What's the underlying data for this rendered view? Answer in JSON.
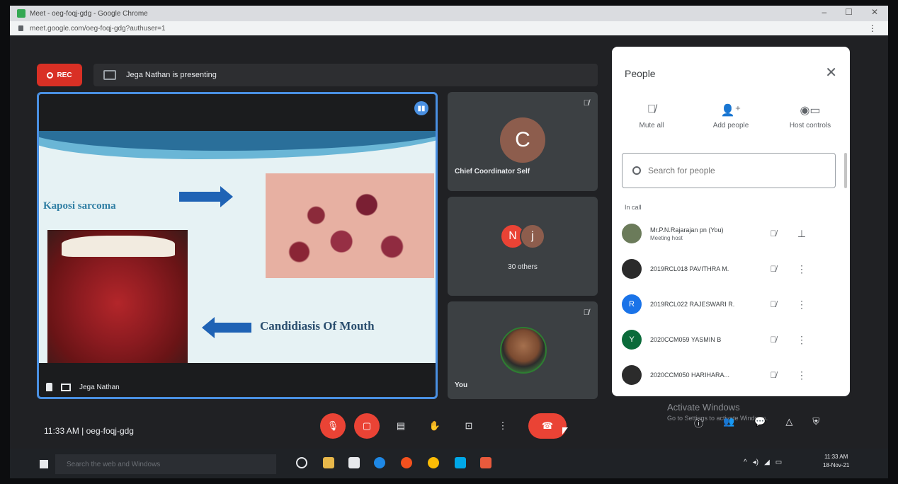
{
  "browser": {
    "title": "Meet - oeg-foqj-gdg - Google Chrome",
    "url": "meet.google.com/oeg-foqj-gdg?authuser=1"
  },
  "topbar": {
    "rec_label": "REC",
    "presenting_text": "Jega Nathan is presenting"
  },
  "main_tile": {
    "presenter_name": "Jega Nathan",
    "slide": {
      "label_top": "Kaposi sarcoma",
      "label_bottom": "Candidiasis Of Mouth"
    }
  },
  "side_tiles": {
    "coordinator": {
      "initial": "C",
      "name": "Chief Coordinator Self"
    },
    "others": {
      "initial_1": "N",
      "initial_2": "j",
      "label": "30 others"
    },
    "you": {
      "name": "You"
    }
  },
  "people_panel": {
    "title": "People",
    "actions": [
      {
        "label": "Mute all",
        "icon": "mic-off-icon"
      },
      {
        "label": "Add people",
        "icon": "add-person-icon"
      },
      {
        "label": "Host controls",
        "icon": "toggle-icon"
      }
    ],
    "search_placeholder": "Search for people",
    "section_label": "In call",
    "participants": [
      {
        "name": "Mr.P.N.Rajarajan pn (You)",
        "sub": "Meeting host",
        "initial": "",
        "color": "#6b7b5a"
      },
      {
        "name": "2019RCL018 PAVITHRA M.",
        "sub": "",
        "initial": "",
        "color": "#2b2b2b"
      },
      {
        "name": "2019RCL022 RAJESWARI R.",
        "sub": "",
        "initial": "R",
        "color": "#1a73e8"
      },
      {
        "name": "2020CCM059 YASMIN B",
        "sub": "",
        "initial": "Y",
        "color": "#0b6b3a"
      },
      {
        "name": "2020CCM050 HARIHARA...",
        "sub": "",
        "initial": "",
        "color": "#2b2b2b"
      }
    ]
  },
  "bottom": {
    "meeting_info": "11:33 AM | oeg-foqj-gdg",
    "activate_title": "Activate Windows",
    "activate_sub": "Go to Settings to activate Windows."
  },
  "taskbar": {
    "search_placeholder": "Search the web and Windows",
    "clock_time": "11:33 AM",
    "clock_date": "18-Nov-21"
  }
}
